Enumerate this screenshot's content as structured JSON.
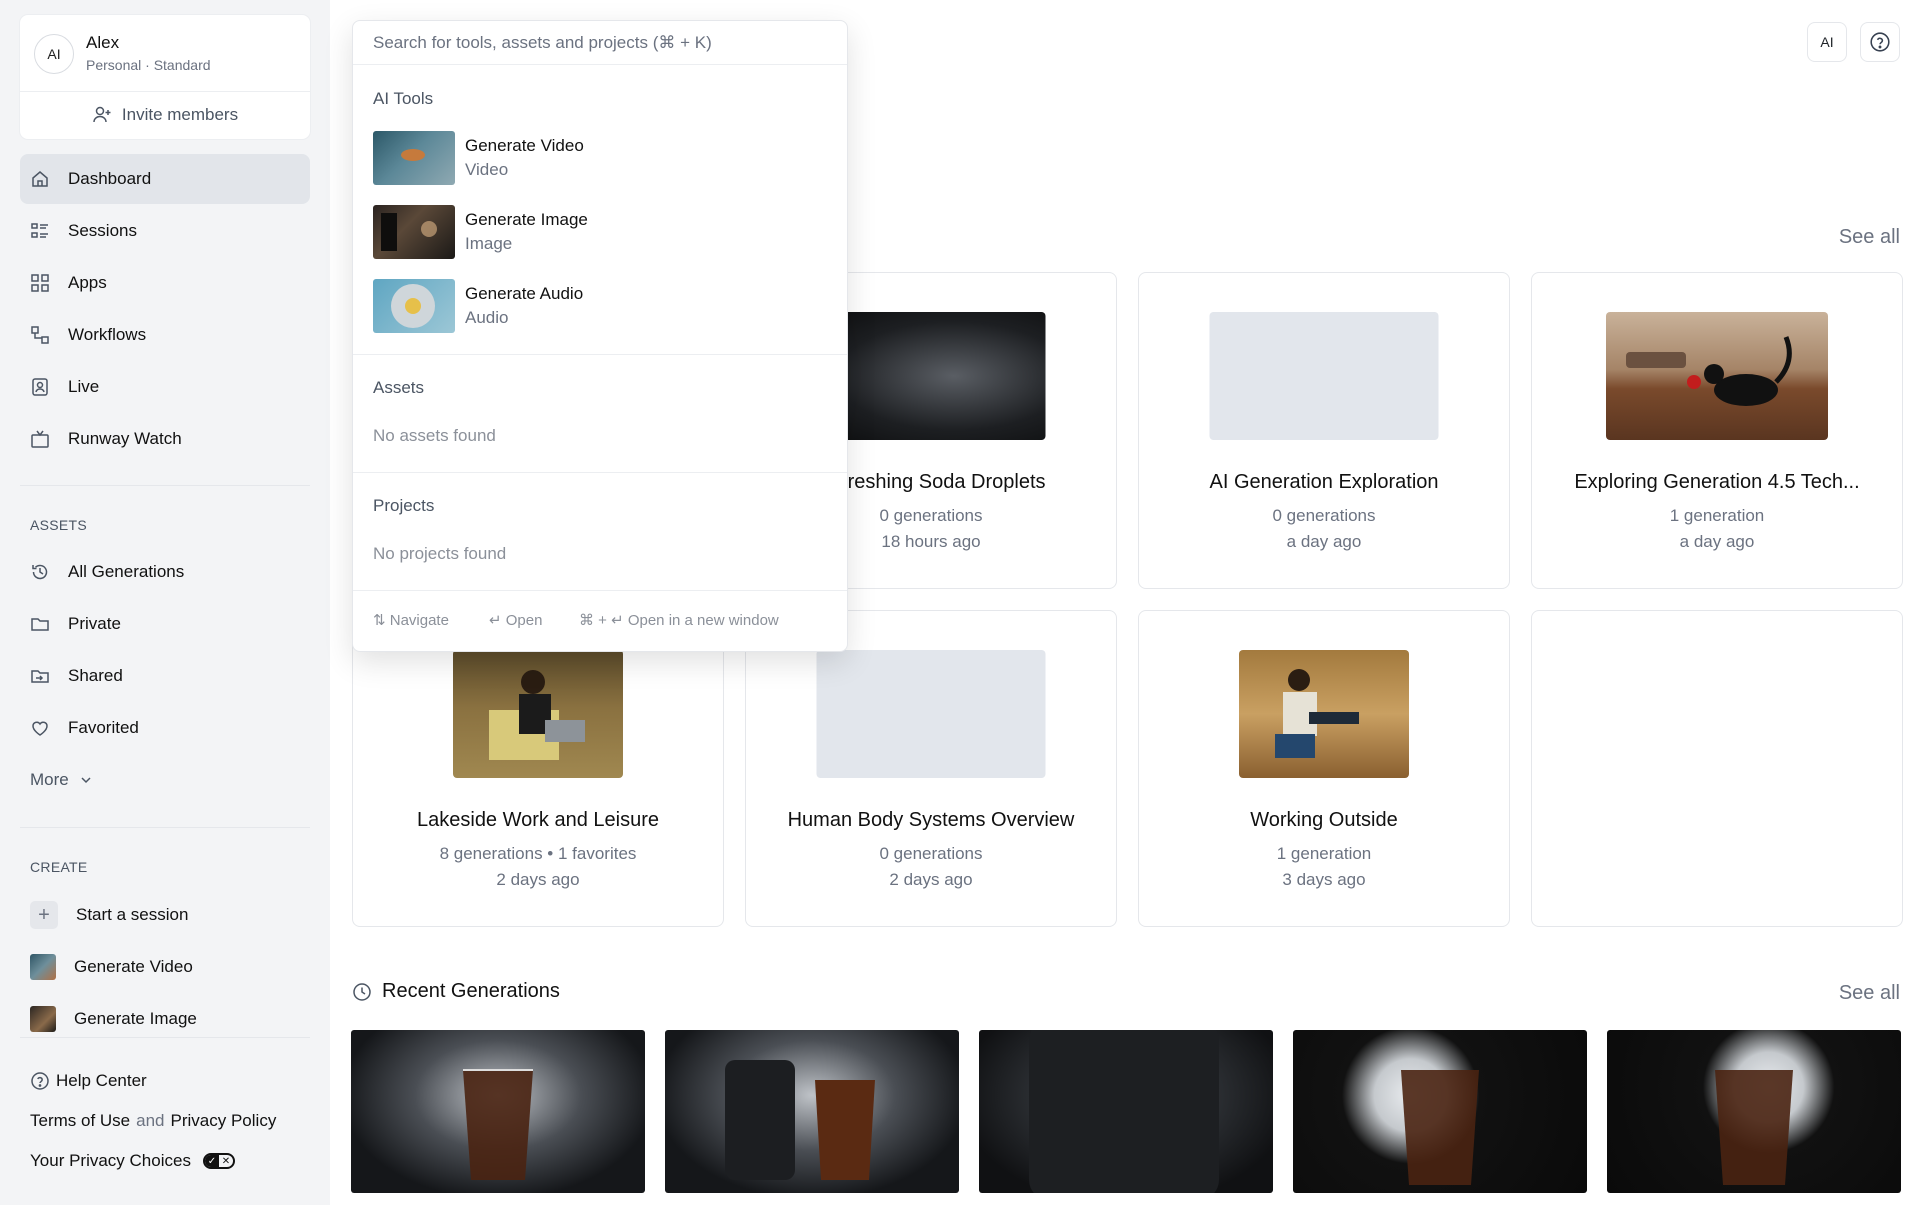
{
  "account": {
    "avatar": "AI",
    "name": "Alex",
    "plan": "Personal · Standard",
    "invite_label": "Invite members"
  },
  "nav": {
    "items": [
      {
        "label": "Dashboard",
        "icon": "home-icon"
      },
      {
        "label": "Sessions",
        "icon": "sessions-icon"
      },
      {
        "label": "Apps",
        "icon": "apps-icon"
      },
      {
        "label": "Workflows",
        "icon": "workflows-icon"
      },
      {
        "label": "Live",
        "icon": "live-icon"
      },
      {
        "label": "Runway Watch",
        "icon": "tv-icon"
      }
    ]
  },
  "assets": {
    "section_label": "ASSETS",
    "items": [
      {
        "label": "All Generations",
        "icon": "history-icon"
      },
      {
        "label": "Private",
        "icon": "folder-icon"
      },
      {
        "label": "Shared",
        "icon": "shared-folder-icon"
      },
      {
        "label": "Favorited",
        "icon": "heart-icon"
      }
    ],
    "more_label": "More"
  },
  "create": {
    "section_label": "CREATE",
    "items": [
      {
        "label": "Start a session"
      },
      {
        "label": "Generate Video"
      },
      {
        "label": "Generate Image"
      }
    ]
  },
  "footer": {
    "help": "Help Center",
    "terms": "Terms of Use",
    "and": "and",
    "privacy": "Privacy Policy",
    "privacy_choices": "Your Privacy Choices"
  },
  "topbar": {
    "ai_button": "AI",
    "help_icon": "help-circle-icon"
  },
  "projects": {
    "see_all": "See all",
    "cards": [
      {
        "title": "Refreshing Soda Droplets",
        "sub1": "0 generations",
        "sub2": "18 hours ago"
      },
      {
        "title": "AI Generation Exploration",
        "sub1": "0 generations",
        "sub2": "a day ago"
      },
      {
        "title": "Exploring Generation 4.5 Tech...",
        "sub1": "1 generation",
        "sub2": "a day ago"
      },
      {
        "title": "Lakeside Work and Leisure",
        "sub1": "8 generations • 1 favorites",
        "sub2": "2 days ago"
      },
      {
        "title": "Human Body Systems Overview",
        "sub1": "0 generations",
        "sub2": "2 days ago"
      },
      {
        "title": "Working Outside",
        "sub1": "1 generation",
        "sub2": "3 days ago"
      }
    ]
  },
  "recent": {
    "title": "Recent Generations",
    "see_all": "See all"
  },
  "search": {
    "placeholder": "Search for tools, assets and projects (⌘ + K)",
    "ai_tools_label": "AI Tools",
    "tools": [
      {
        "title": "Generate Video",
        "type": "Video"
      },
      {
        "title": "Generate Image",
        "type": "Image"
      },
      {
        "title": "Generate Audio",
        "type": "Audio"
      }
    ],
    "assets_label": "Assets",
    "assets_empty": "No assets found",
    "projects_label": "Projects",
    "projects_empty": "No projects found",
    "hints": {
      "navigate": "⇅ Navigate",
      "open": "↵ Open",
      "open_new": "⌘ + ↵ Open in a new window"
    }
  }
}
